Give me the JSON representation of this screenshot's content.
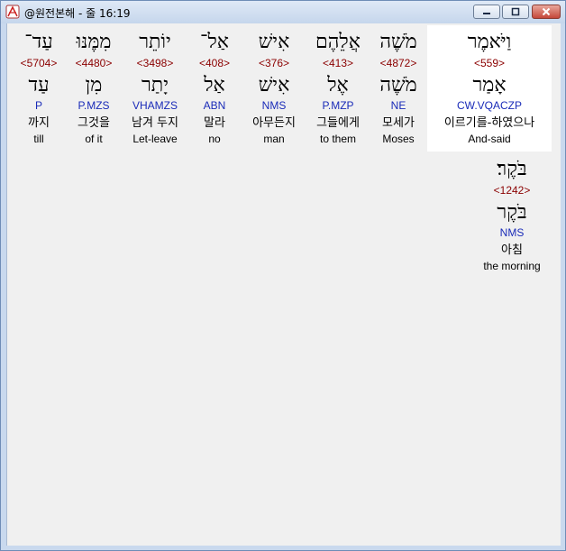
{
  "window": {
    "title": "@원전본해 - 줄 16:19"
  },
  "words": [
    {
      "hebrew": "וַיֹּאמֶר",
      "strong": "<559>",
      "lemma": "אָמַר",
      "morph": "CW.VQACZP",
      "korean": "이르기를-하였으나",
      "english": "And-said"
    },
    {
      "hebrew": "מֹשֶׁה",
      "strong": "<4872>",
      "lemma": "מֹשֶׁה",
      "morph": "NE",
      "korean": "모세가",
      "english": "Moses"
    },
    {
      "hebrew": "אֲלֵהֶם",
      "strong": "<413>",
      "lemma": "אֶל",
      "morph": "P.MZP",
      "korean": "그들에게",
      "english": "to them"
    },
    {
      "hebrew": "אִישׁ",
      "strong": "<376>",
      "lemma": "אִישׁ",
      "morph": "NMS",
      "korean": "아무든지",
      "english": "man"
    },
    {
      "hebrew": "אַל־",
      "strong": "<408>",
      "lemma": "אַל",
      "morph": "ABN",
      "korean": "말라",
      "english": "no"
    },
    {
      "hebrew": "יוֹתֵר",
      "strong": "<3498>",
      "lemma": "יָתַר",
      "morph": "VHAMZS",
      "korean": "남겨 두지",
      "english": "Let-leave"
    },
    {
      "hebrew": "מִמֶּנּוּ",
      "strong": "<4480>",
      "lemma": "מִן",
      "morph": "P.MZS",
      "korean": "그것을",
      "english": "of it"
    },
    {
      "hebrew": "עַד־",
      "strong": "<5704>",
      "lemma": "עַד",
      "morph": "P",
      "korean": "까지",
      "english": "till"
    },
    {
      "hebrew": "בֹּקֶר׃",
      "strong": "<1242>",
      "lemma": "בֹּקֶר",
      "morph": "NMS",
      "korean": "아침",
      "english": "the morning"
    }
  ],
  "colors": {
    "strong": "#8b0000",
    "morph": "#1a2bb8",
    "highlight": "#ffffff"
  },
  "icons": {
    "app": "compass-icon",
    "minimize": "minimize-icon",
    "maximize": "maximize-icon",
    "close": "close-icon"
  }
}
